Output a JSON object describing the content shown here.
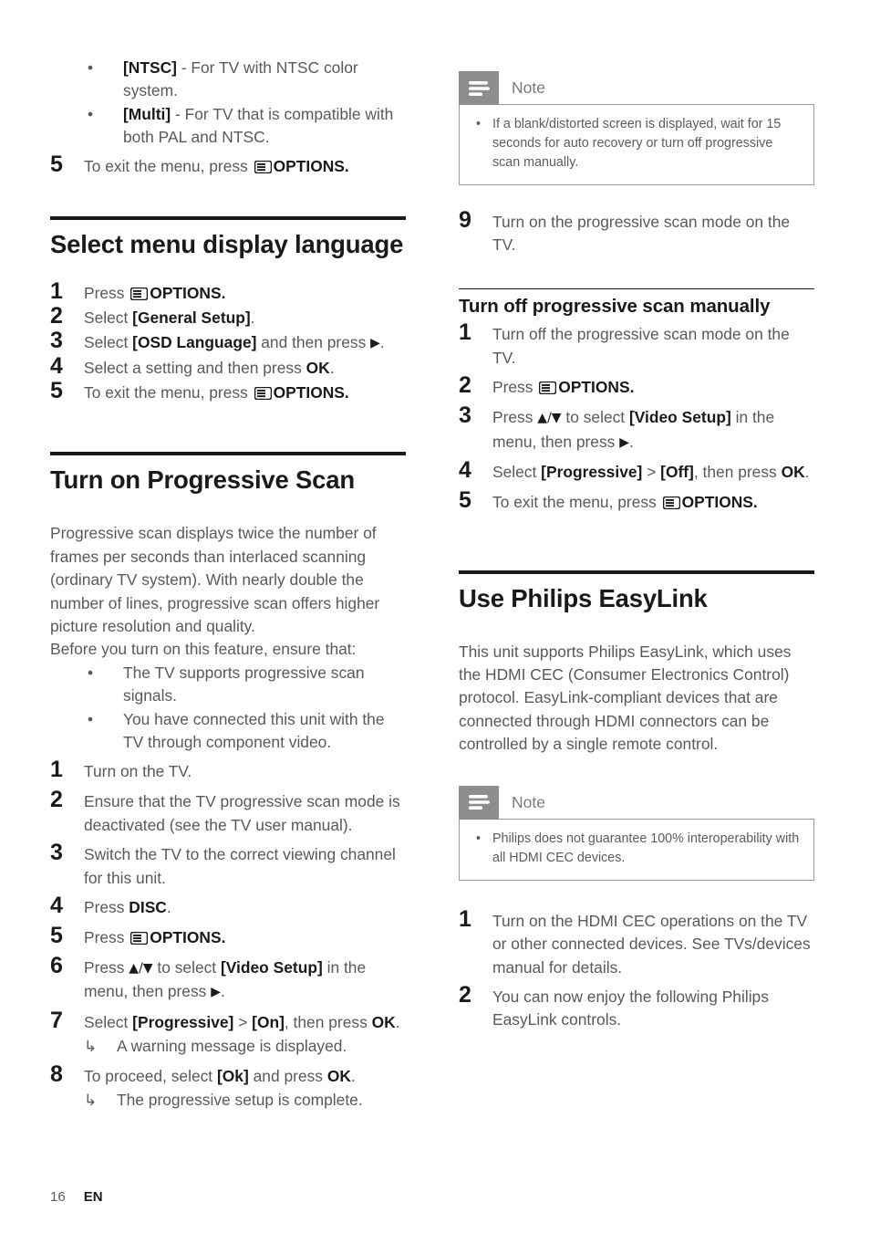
{
  "page": {
    "number": "16",
    "language": "EN"
  },
  "icons": {
    "options": "options-menu-icon",
    "note": "note-lines-icon",
    "bullet": "•",
    "result_arrow": "↳",
    "up_down": "▲/▼",
    "right": "▶"
  },
  "left_column": {
    "top_bullets": [
      {
        "term": "[NTSC]",
        "text": " - For TV with NTSC color system."
      },
      {
        "term": "[Multi]",
        "text": " - For TV that is compatible with both PAL and NTSC."
      }
    ],
    "top_step": {
      "num": "5",
      "pre": "To exit the menu, press ",
      "post": "OPTIONS."
    },
    "section_language": {
      "title": "Select menu display language",
      "steps": [
        {
          "num": "1",
          "pre": "Press ",
          "post": "OPTIONS.",
          "has_icon": true
        },
        {
          "num": "2",
          "text_a": "Select ",
          "bold_a": "[General Setup]",
          "text_b": "."
        },
        {
          "num": "3",
          "text_a": "Select ",
          "bold_a": "[OSD Language]",
          "text_b": " and then press ",
          "glyph": "▶",
          "text_c": "."
        },
        {
          "num": "4",
          "text_a": "Select a setting and then press ",
          "bold_a": "OK",
          "text_b": "."
        },
        {
          "num": "5",
          "pre": "To exit the menu, press ",
          "post": "OPTIONS.",
          "has_icon": true
        }
      ]
    },
    "section_progressive": {
      "title": "Turn on Progressive Scan",
      "intro_paragraphs": [
        "Progressive scan displays twice the number of frames per seconds than interlaced scanning (ordinary TV system). With nearly double the number of lines, progressive scan offers higher picture resolution and quality.",
        "Before you turn on this feature, ensure that:"
      ],
      "bullets": [
        "The TV supports progressive scan signals.",
        "You have connected this unit with the TV through component video."
      ],
      "steps": [
        {
          "num": "1",
          "text_a": "Turn on the TV."
        },
        {
          "num": "2",
          "text_a": "Ensure that the TV progressive scan mode is deactivated (see the TV user manual)."
        },
        {
          "num": "3",
          "text_a": "Switch the TV to the correct viewing channel for this unit."
        },
        {
          "num": "4",
          "text_a": "Press ",
          "bold_a": "DISC",
          "text_b": "."
        },
        {
          "num": "5",
          "pre": "Press ",
          "post": "OPTIONS.",
          "has_icon": true
        },
        {
          "num": "6",
          "text_a": "Press ",
          "glyph_a": "▲/▼",
          "text_b": " to select ",
          "bold_a": "[Video Setup]",
          "text_c": " in the menu, then press ",
          "glyph_b": "▶",
          "text_d": "."
        },
        {
          "num": "7",
          "text_a": "Select ",
          "bold_a": "[Progressive]",
          "text_b": " > ",
          "bold_b": "[On]",
          "text_c": ", then press ",
          "bold_c": "OK",
          "text_d": ".",
          "result": "A warning message is displayed."
        },
        {
          "num": "8",
          "text_a": "To proceed, select ",
          "bold_a": "[Ok]",
          "text_b": " and press ",
          "bold_b": "OK",
          "text_c": ".",
          "result": "The progressive setup is complete."
        }
      ]
    }
  },
  "right_column": {
    "note_top": {
      "label": "Note",
      "items": [
        "If a blank/distorted screen is displayed, wait for 15 seconds for auto recovery or turn off progressive scan manually."
      ]
    },
    "step_nine": {
      "num": "9",
      "text_a": "Turn on the progressive scan mode on the TV."
    },
    "section_turn_off": {
      "title": "Turn off progressive scan manually",
      "steps": [
        {
          "num": "1",
          "text_a": "Turn off the progressive scan mode on the TV."
        },
        {
          "num": "2",
          "pre": "Press ",
          "post": "OPTIONS.",
          "has_icon": true
        },
        {
          "num": "3",
          "text_a": "Press ",
          "glyph_a": "▲/▼",
          "text_b": " to select ",
          "bold_a": "[Video Setup]",
          "text_c": " in the menu, then press ",
          "glyph_b": "▶",
          "text_d": "."
        },
        {
          "num": "4",
          "text_a": "Select ",
          "bold_a": "[Progressive]",
          "text_b": " > ",
          "bold_b": "[Off]",
          "text_c": ", then press ",
          "bold_c": "OK",
          "text_d": "."
        },
        {
          "num": "5",
          "pre": "To exit the menu, press ",
          "post": "OPTIONS.",
          "has_icon": true
        }
      ]
    },
    "section_easylink": {
      "title": "Use Philips EasyLink",
      "intro": "This unit supports Philips EasyLink, which uses the HDMI CEC (Consumer Electronics Control) protocol. EasyLink-compliant devices that are connected through HDMI connectors can be controlled by a single remote control.",
      "note": {
        "label": "Note",
        "items": [
          "Philips does not guarantee 100% interoperability with all HDMI CEC devices."
        ]
      },
      "steps": [
        {
          "num": "1",
          "text_a": "Turn on the HDMI CEC operations on the TV or other connected devices. See TVs/devices manual for details."
        },
        {
          "num": "2",
          "text_a": "You can now enjoy the following Philips EasyLink controls."
        }
      ]
    }
  },
  "colors": {
    "body_text": "#59595b",
    "heading": "#1a1a1a",
    "note_tab": "#8d8d8d",
    "note_border": "#9a9a9a",
    "note_label": "#7a7a7a"
  }
}
